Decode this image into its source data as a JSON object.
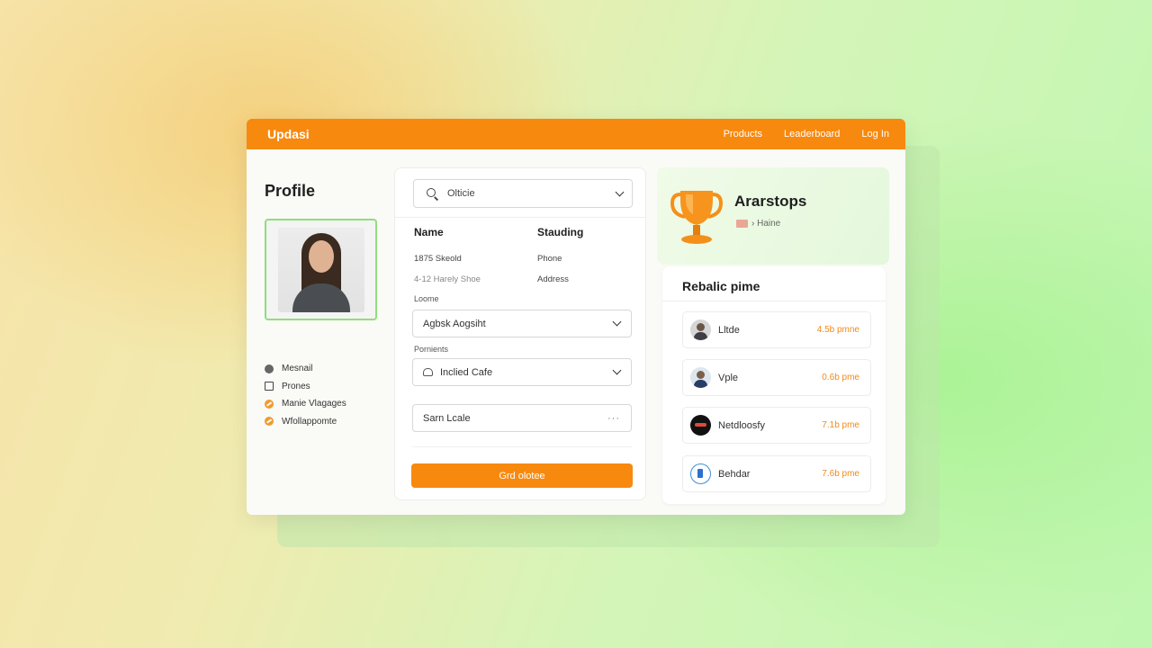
{
  "header": {
    "brand": "Updasi",
    "nav": [
      "Products",
      "Leaderboard",
      "Log In"
    ]
  },
  "profile": {
    "title": "Profile",
    "menu": [
      {
        "label": "Mesnail",
        "icon": "circle-icon"
      },
      {
        "label": "Prones",
        "icon": "square-icon"
      },
      {
        "label": "Manie Vlagages",
        "icon": "badge-icon"
      },
      {
        "label": "Wfollappomte",
        "icon": "badge-icon"
      }
    ]
  },
  "form": {
    "search_value": "Olticie",
    "columns": [
      "Name",
      "Stauding"
    ],
    "rows": [
      [
        "1875 Skeold",
        "Phone"
      ],
      [
        "4-12 Harely Shoe",
        "Address"
      ]
    ],
    "location_label": "Loome",
    "location_value": "Agbsk Aogsiht",
    "preference_label": "Pornients",
    "preference_value": "Inclied Cafe",
    "extra_value": "Sarn Lcale",
    "extra_more": "···",
    "submit_label": "Grd olotee"
  },
  "achievements": {
    "title": "Ararstops",
    "subtitle": "› Haine"
  },
  "leaderboard": {
    "title": "Rebalic pime",
    "items": [
      {
        "name": "Lltde",
        "value": "4.5b pmne"
      },
      {
        "name": "Vple",
        "value": "0.6b pme"
      },
      {
        "name": "Netdloosfy",
        "value": "7.1b pme"
      },
      {
        "name": "Behdar",
        "value": "7.6b pme"
      }
    ]
  },
  "colors": {
    "accent": "#f7890f",
    "avatar_border": "#8ee07a"
  }
}
